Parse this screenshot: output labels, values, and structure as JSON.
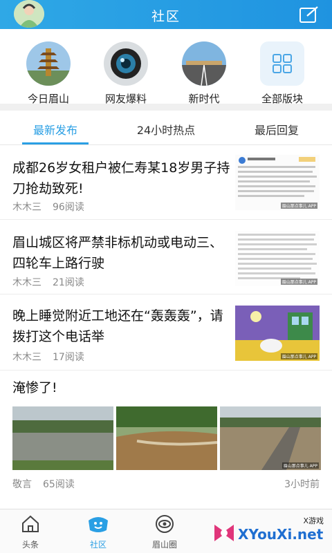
{
  "header": {
    "title": "社区"
  },
  "categories": [
    {
      "label": "今日眉山",
      "icon": "pagoda-photo"
    },
    {
      "label": "网友爆料",
      "icon": "camera-lens-photo"
    },
    {
      "label": "新时代",
      "icon": "road-photo"
    },
    {
      "label": "全部版块",
      "icon": "grid-icon"
    }
  ],
  "tabs": [
    {
      "label": "最新发布",
      "active": true
    },
    {
      "label": "24小时热点",
      "active": false
    },
    {
      "label": "最后回复",
      "active": false
    }
  ],
  "articles": [
    {
      "title": "成都26岁女租户被仁寿某18岁男子持刀抢劫致死!",
      "author": "木木三",
      "reads": "96阅读",
      "thumb_caption": "眉山那点事儿 APP"
    },
    {
      "title": "眉山城区将严禁非标机动或电动三、四轮车上路行驶",
      "author": "木木三",
      "reads": "21阅读",
      "thumb_caption": "眉山那点事儿 APP"
    },
    {
      "title": "晚上睡觉附近工地还在“轰轰轰”，请拨打这个电话举",
      "author": "木木三",
      "reads": "17阅读",
      "thumb_caption": "眉山那点事儿 APP"
    }
  ],
  "flood_post": {
    "title": "淹惨了!",
    "author": "敬言",
    "reads": "65阅读",
    "time": "3小时前",
    "image_caption": "眉山那点事儿 APP"
  },
  "bottom_nav": [
    {
      "label": "头条",
      "icon": "home-icon",
      "active": false
    },
    {
      "label": "社区",
      "icon": "community-icon",
      "active": true
    },
    {
      "label": "眉山圈",
      "icon": "eye-circle-icon",
      "active": false
    }
  ],
  "watermark": {
    "text": "XYouXi.net",
    "small": "X游戏"
  },
  "colors": {
    "accent": "#2a9fe4",
    "header": "#1f93e0"
  }
}
